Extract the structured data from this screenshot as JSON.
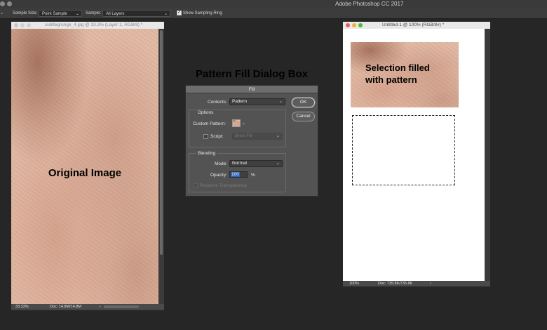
{
  "app": {
    "title": "Adobe Photoshop CC 2017"
  },
  "options_bar": {
    "sample_size_label": "Sample Size:",
    "sample_size_value": "Point Sample",
    "sample_label": "Sample:",
    "sample_value": "All Layers",
    "show_sampling_ring_label": "Show Sampling Ring",
    "show_sampling_ring_checked": true
  },
  "left_document": {
    "title": "subtlegrunge_4.jpg @ 33.3% (Layer 1, RGB/8) *",
    "zoom": "33.33%",
    "doc_info": "Doc: 14.8M/14.8M",
    "annotation": "Original Image"
  },
  "right_document": {
    "title": "Untitled-1 @ 100% (RGB/8#) *",
    "zoom": "100%",
    "doc_info": "Doc: 735.8K/735.8K",
    "annotation_line1": "Selection filled",
    "annotation_line2": "with pattern"
  },
  "dialog_caption": "Pattern Fill Dialog Box",
  "fill_dialog": {
    "title": "Fill",
    "contents_label": "Contents:",
    "contents_value": "Pattern",
    "options_heading": "Options",
    "custom_pattern_label": "Custom Pattern:",
    "script_label": "Script:",
    "script_value": "Brick Fill",
    "blending_heading": "Blending",
    "mode_label": "Mode:",
    "mode_value": "Normal",
    "opacity_label": "Opacity:",
    "opacity_value": "100",
    "opacity_unit": "%",
    "preserve_transparency_label": "Preserve Transparency",
    "ok_label": "OK",
    "cancel_label": "Cancel"
  },
  "colors": {
    "texture_base": "#dfb6a0",
    "dialog_bg": "#535353",
    "workspace_bg": "#262626",
    "opacity_highlight": "#2f63b5"
  }
}
